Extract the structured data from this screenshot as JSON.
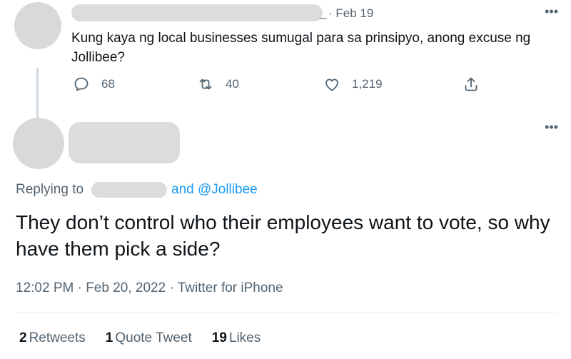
{
  "first_tweet": {
    "date": "· Feb 19",
    "text": "Kung kaya ng local businesses sumugal para sa prinsipyo, anong excuse ng Jollibee?",
    "more": "•••",
    "replies": "68",
    "retweets": "40",
    "likes": "1,219"
  },
  "main_tweet": {
    "more": "•••",
    "replying_to_label": "Replying to",
    "replying_mentions": "and @Jollibee",
    "text": "They don’t control who their employees want to vote, so why have them pick a side?",
    "meta": "12:02 PM · Feb 20, 2022 · Twitter for iPhone",
    "stats": {
      "retweets_count": "2",
      "retweets_label": "Retweets",
      "quotes_count": "1",
      "quotes_label": "Quote Tweet",
      "likes_count": "19",
      "likes_label": "Likes"
    }
  },
  "icons": [
    "reply-icon",
    "retweet-icon",
    "like-icon",
    "share-icon",
    "more-icon"
  ],
  "colors": {
    "text": "#0f1419",
    "secondary": "#536471",
    "link": "#1d9bf0",
    "redaction": "#dcdcdc"
  }
}
